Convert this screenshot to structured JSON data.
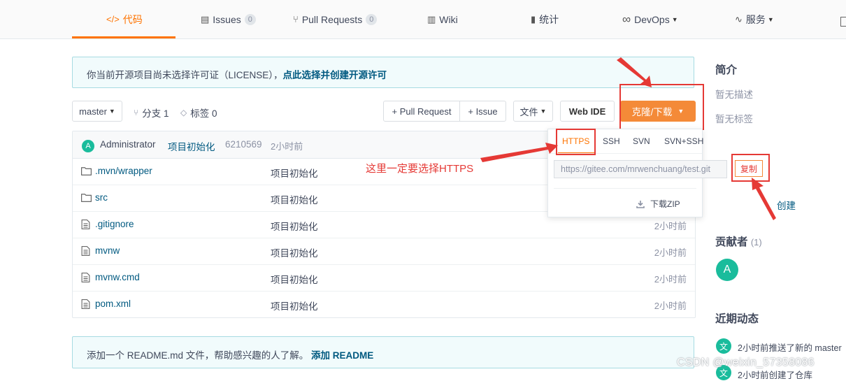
{
  "nav": {
    "tabs": [
      {
        "icon": "code-icon",
        "glyph": "</>",
        "label": "代码"
      },
      {
        "icon": "issues-icon",
        "glyph": "▤",
        "label": "Issues",
        "count": "0"
      },
      {
        "icon": "pull-request-icon",
        "glyph": "⑂",
        "label": "Pull Requests",
        "count": "0"
      },
      {
        "icon": "wiki-icon",
        "glyph": "▥",
        "label": "Wiki"
      },
      {
        "icon": "stats-icon",
        "glyph": "▮",
        "label": "统计"
      },
      {
        "icon": "devops-icon",
        "glyph": "∞",
        "label": "DevOps"
      },
      {
        "icon": "service-icon",
        "glyph": "∿",
        "label": "服务"
      }
    ]
  },
  "notice": {
    "text": "你当前开源项目尚未选择许可证（LICENSE），",
    "link": "点此选择并创建开源许可"
  },
  "toolbar": {
    "branch": "master",
    "branches_label": "分支 1",
    "tags_label": "标签 0",
    "pull_request": "+ Pull Request",
    "issue": "+ Issue",
    "file": "文件",
    "web_ide": "Web IDE",
    "clone": "克隆/下载"
  },
  "commit": {
    "avatar": "A",
    "author": "Administrator",
    "message": "项目初始化",
    "hash": "6210569",
    "time": "2小时前"
  },
  "files": [
    {
      "type": "folder",
      "name": ".mvn/wrapper",
      "message": "项目初始化",
      "time": ""
    },
    {
      "type": "folder",
      "name": "src",
      "message": "项目初始化",
      "time": ""
    },
    {
      "type": "file",
      "name": ".gitignore",
      "message": "项目初始化",
      "time": "2小时前"
    },
    {
      "type": "file",
      "name": "mvnw",
      "message": "项目初始化",
      "time": "2小时前"
    },
    {
      "type": "file",
      "name": "mvnw.cmd",
      "message": "项目初始化",
      "time": "2小时前"
    },
    {
      "type": "file",
      "name": "pom.xml",
      "message": "项目初始化",
      "time": "2小时前"
    }
  ],
  "clone_panel": {
    "tabs": [
      "HTTPS",
      "SSH",
      "SVN",
      "SVN+SSH"
    ],
    "active": "HTTPS",
    "url": "https://gitee.com/mrwenchuang/test.git",
    "copy": "复制",
    "download_zip": "下载ZIP"
  },
  "annotation": {
    "text": "这里一定要选择HTTPS"
  },
  "readme": {
    "text": "添加一个 README.md 文件，帮助感兴趣的人了解。",
    "link": "添加 README"
  },
  "sidebar": {
    "intro_title": "简介",
    "no_desc": "暂无描述",
    "no_tags": "暂无标签",
    "create_link": "创建",
    "contributors_title": "贡献者",
    "contributors_count": "(1)",
    "contributor_avatar": "A",
    "activity_title": "近期动态",
    "activities": [
      {
        "avatar": "文",
        "text": "2小时前推送了新的 master"
      },
      {
        "avatar": "文",
        "text": "2小时前创建了仓库"
      }
    ]
  },
  "watermark": "CSDN @weixin_57358086",
  "colors": {
    "accent": "#fe7300",
    "clone_button": "#f48a38",
    "annotation_red": "#e53935",
    "link": "#005980",
    "avatar": "#1abc9c"
  }
}
